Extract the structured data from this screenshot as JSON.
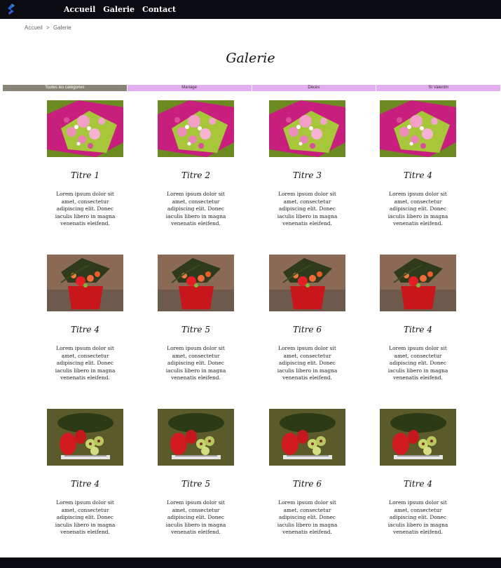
{
  "nav": {
    "items": [
      "Accueil",
      "Galerie",
      "Contact"
    ]
  },
  "breadcrumb": {
    "home": "Accueil",
    "separator": ">",
    "current": "Galerie"
  },
  "page": {
    "title": "Galerie"
  },
  "filters": [
    {
      "label": "Toutes les catégories",
      "active": true
    },
    {
      "label": "Mariage",
      "active": false
    },
    {
      "label": "Décès",
      "active": false
    },
    {
      "label": "St Valentin",
      "active": false
    }
  ],
  "gallery": {
    "rows": [
      {
        "image": "pink-bouquet-photo",
        "cards": [
          {
            "title": "Titre 1",
            "text": "Lorem ipsum dolor sit amet, consectetur adipiscing elit. Donec iaculis libero in magna venenatis eleifend."
          },
          {
            "title": "Titre 2",
            "text": "Lorem ipsum dolor sit amet, consectetur adipiscing elit. Donec iaculis libero in magna venenatis eleifend."
          },
          {
            "title": "Titre 3",
            "text": "Lorem ipsum dolor sit amet, consectetur adipiscing elit. Donec iaculis libero in magna venenatis eleifend."
          },
          {
            "title": "Titre 4",
            "text": "Lorem ipsum dolor sit amet, consectetur adipiscing elit. Donec iaculis libero in magna venenatis eleifend."
          }
        ]
      },
      {
        "image": "red-box-arrangement-photo",
        "cards": [
          {
            "title": "Titre 4",
            "text": "Lorem ipsum dolor sit amet, consectetur adipiscing elit. Donec iaculis libero in magna venenatis eleifend."
          },
          {
            "title": "Titre 5",
            "text": "Lorem ipsum dolor sit amet, consectetur adipiscing elit. Donec iaculis libero in magna venenatis eleifend."
          },
          {
            "title": "Titre 6",
            "text": "Lorem ipsum dolor sit amet, consectetur adipiscing elit. Donec iaculis libero in magna venenatis eleifend."
          },
          {
            "title": "Titre 4",
            "text": "Lorem ipsum dolor sit amet, consectetur adipiscing elit. Donec iaculis libero in magna venenatis eleifend."
          }
        ]
      },
      {
        "image": "anthurium-orchid-photo",
        "cards": [
          {
            "title": "Titre 4",
            "text": "Lorem ipsum dolor sit amet, consectetur adipiscing elit. Donec iaculis libero in magna venenatis eleifend."
          },
          {
            "title": "Titre 5",
            "text": "Lorem ipsum dolor sit amet, consectetur adipiscing elit. Donec iaculis libero in magna venenatis eleifend."
          },
          {
            "title": "Titre 6",
            "text": "Lorem ipsum dolor sit amet, consectetur adipiscing elit. Donec iaculis libero in magna venenatis eleifend."
          },
          {
            "title": "Titre 4",
            "text": "Lorem ipsum dolor sit amet, consectetur adipiscing elit. Donec iaculis libero in magna venenatis eleifend."
          }
        ]
      }
    ]
  },
  "colors": {
    "bar": "#0b0c12",
    "filter_active": "#8a8478",
    "filter_inactive": "#e3aef0"
  }
}
